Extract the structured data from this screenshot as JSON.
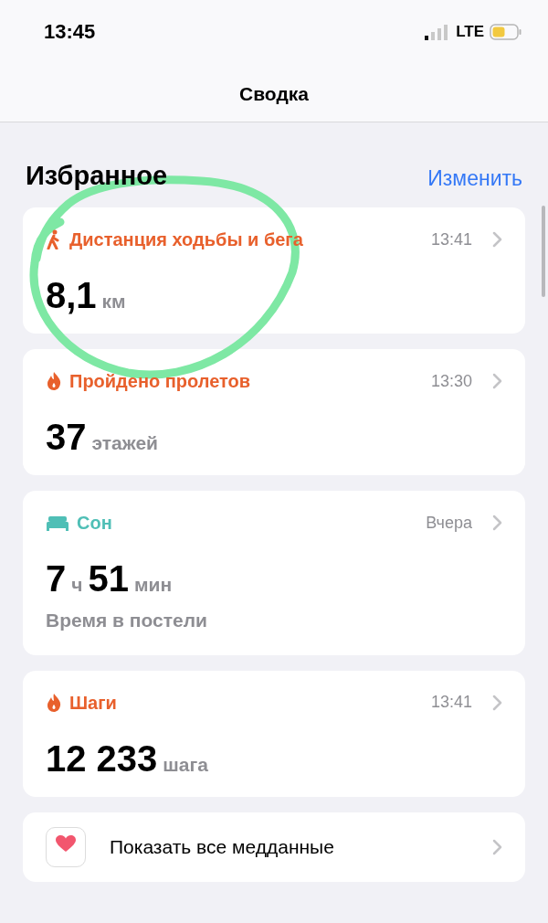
{
  "status_bar": {
    "time": "13:45",
    "network": "LTE"
  },
  "nav": {
    "title": "Сводка"
  },
  "favorites": {
    "title": "Избранное",
    "edit": "Изменить"
  },
  "cards": [
    {
      "kind": "walk",
      "color": "#e8602c",
      "title": "Дистанция ходьбы и бега",
      "time": "13:41",
      "value": [
        {
          "kind": "number",
          "text": "8,1"
        },
        {
          "kind": "unit",
          "text": "км"
        }
      ]
    },
    {
      "kind": "flame",
      "color": "#e8602c",
      "title": "Пройдено пролетов",
      "time": "13:30",
      "value": [
        {
          "kind": "number",
          "text": "37"
        },
        {
          "kind": "unit",
          "text": "этажей"
        }
      ]
    },
    {
      "kind": "bed",
      "color": "#4fbfb6",
      "title": "Сон",
      "time": "Вчера",
      "value": [
        {
          "kind": "number",
          "text": "7"
        },
        {
          "kind": "unit",
          "text": "ч"
        },
        {
          "kind": "number",
          "text": "51"
        },
        {
          "kind": "unit",
          "text": "мин"
        }
      ],
      "caption": "Время в постели"
    },
    {
      "kind": "flame",
      "color": "#e8602c",
      "title": "Шаги",
      "time": "13:41",
      "value": [
        {
          "kind": "number",
          "text": "12 233"
        },
        {
          "kind": "unit",
          "text": "шага"
        }
      ]
    }
  ],
  "show_all": {
    "label": "Показать все медданные"
  }
}
